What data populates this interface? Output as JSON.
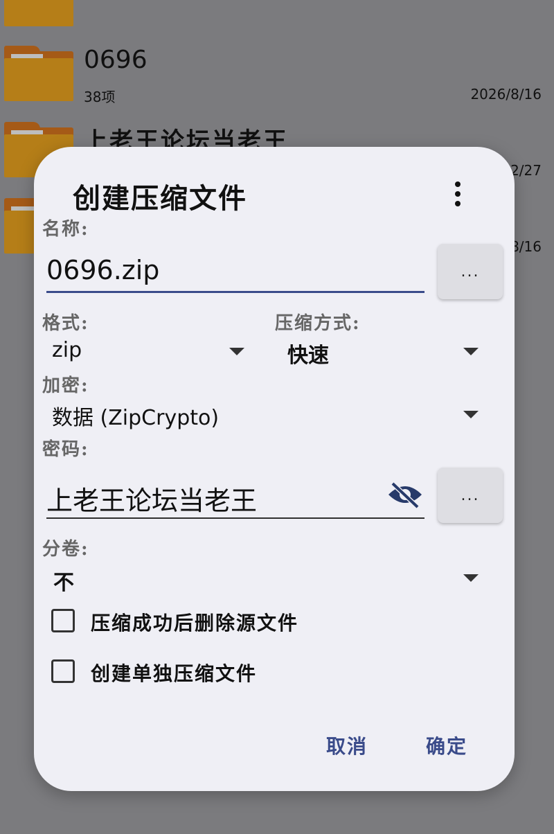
{
  "file_list": [
    {
      "name": "",
      "meta": "",
      "date": ""
    },
    {
      "name": "0696",
      "meta": "38项",
      "date": "2026/8/16"
    },
    {
      "name": "上老王论坛当老王",
      "meta": "",
      "date": "2/27"
    },
    {
      "name": "",
      "meta": "",
      "date": "8/16"
    }
  ],
  "dialog": {
    "title": "创建压缩文件",
    "name_label": "名称:",
    "name_value": "0696.zip",
    "browse_label": "...",
    "format_label": "格式:",
    "format_value": "zip",
    "method_label": "压缩方式:",
    "method_value": "快速",
    "encrypt_label": "加密:",
    "encrypt_value": "数据 (ZipCrypto)",
    "password_label": "密码:",
    "password_value": "上老王论坛当老王",
    "password_btn_label": "...",
    "split_label": "分卷:",
    "split_value": "不",
    "checkbox_delete_label": "压缩成功后删除源文件",
    "checkbox_delete_checked": false,
    "checkbox_separate_label": "创建单独压缩文件",
    "checkbox_separate_checked": false,
    "cancel_label": "取消",
    "ok_label": "确定"
  },
  "colors": {
    "accent": "#3a4b8a",
    "folder": "#b57e18",
    "dialog_bg": "#efeff5",
    "scrim": "#7b7b7e"
  },
  "icons": [
    "folder-icon",
    "more-vert-icon",
    "visibility-off-icon",
    "dropdown-caret-icon"
  ]
}
